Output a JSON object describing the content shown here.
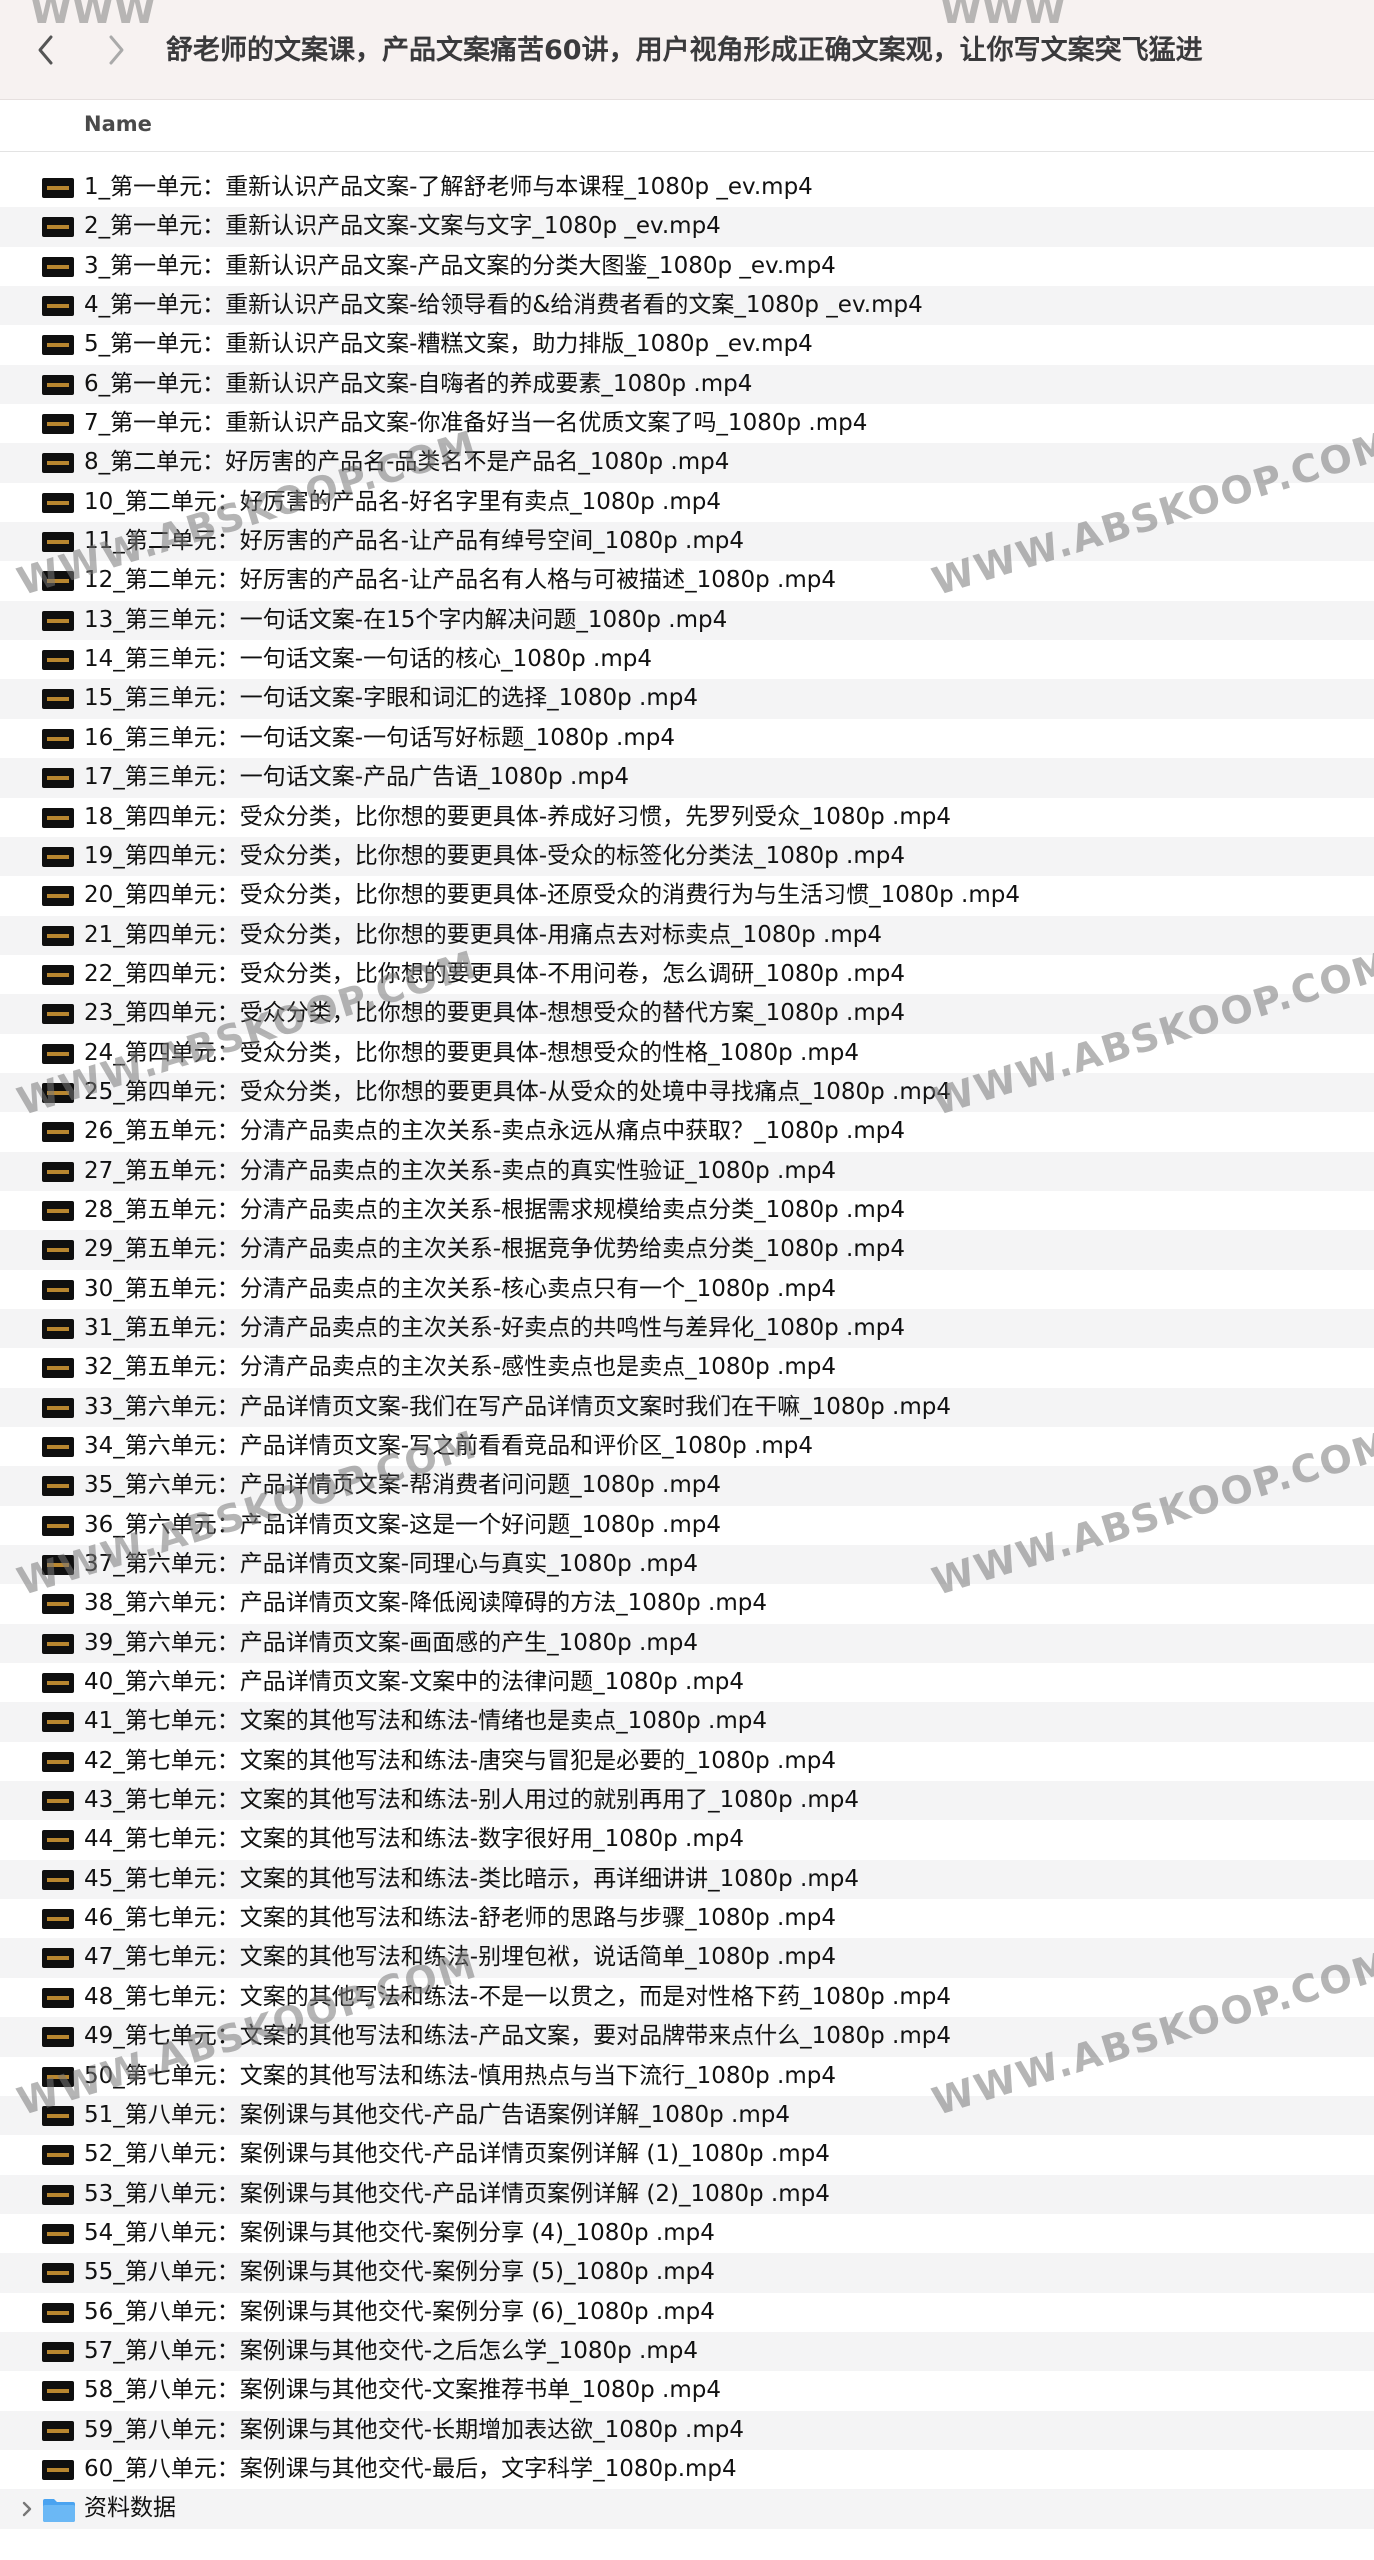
{
  "window": {
    "title": "舒老师的文案课，产品文案痛苦60讲，用户视角形成正确文案观，让你写文案突飞猛进"
  },
  "column_header": {
    "name": "Name"
  },
  "watermark": {
    "text": "WWW.ABSKOOP.COM",
    "partial_text": "WWW"
  },
  "files": [
    "1_第一单元：重新认识产品文案-了解舒老师与本课程_1080p _ev.mp4",
    "2_第一单元：重新认识产品文案-文案与文字_1080p _ev.mp4",
    "3_第一单元：重新认识产品文案-产品文案的分类大图鉴_1080p _ev.mp4",
    "4_第一单元：重新认识产品文案-给领导看的&给消费者看的文案_1080p _ev.mp4",
    "5_第一单元：重新认识产品文案-糟糕文案，助力排版_1080p _ev.mp4",
    "6_第一单元：重新认识产品文案-自嗨者的养成要素_1080p .mp4",
    "7_第一单元：重新认识产品文案-你准备好当一名优质文案了吗_1080p .mp4",
    "8_第二单元：好厉害的产品名-品类名不是产品名_1080p .mp4",
    "10_第二单元：好厉害的产品名-好名字里有卖点_1080p .mp4",
    "11_第二单元：好厉害的产品名-让产品有绰号空间_1080p .mp4",
    "12_第二单元：好厉害的产品名-让产品名有人格与可被描述_1080p .mp4",
    "13_第三单元：一句话文案-在15个字内解决问题_1080p .mp4",
    "14_第三单元：一句话文案-一句话的核心_1080p .mp4",
    "15_第三单元：一句话文案-字眼和词汇的选择_1080p .mp4",
    "16_第三单元：一句话文案-一句话写好标题_1080p .mp4",
    "17_第三单元：一句话文案-产品广告语_1080p .mp4",
    "18_第四单元：受众分类，比你想的要更具体-养成好习惯，先罗列受众_1080p .mp4",
    "19_第四单元：受众分类，比你想的要更具体-受众的标签化分类法_1080p .mp4",
    "20_第四单元：受众分类，比你想的要更具体-还原受众的消费行为与生活习惯_1080p .mp4",
    "21_第四单元：受众分类，比你想的要更具体-用痛点去对标卖点_1080p .mp4",
    "22_第四单元：受众分类，比你想的要更具体-不用问卷，怎么调研_1080p .mp4",
    "23_第四单元：受众分类，比你想的要更具体-想想受众的替代方案_1080p .mp4",
    "24_第四单元：受众分类，比你想的要更具体-想想受众的性格_1080p .mp4",
    "25_第四单元：受众分类，比你想的要更具体-从受众的处境中寻找痛点_1080p .mp4",
    "26_第五单元：分清产品卖点的主次关系-卖点永远从痛点中获取？_1080p .mp4",
    "27_第五单元：分清产品卖点的主次关系-卖点的真实性验证_1080p .mp4",
    "28_第五单元：分清产品卖点的主次关系-根据需求规模给卖点分类_1080p .mp4",
    "29_第五单元：分清产品卖点的主次关系-根据竞争优势给卖点分类_1080p .mp4",
    "30_第五单元：分清产品卖点的主次关系-核心卖点只有一个_1080p .mp4",
    "31_第五单元：分清产品卖点的主次关系-好卖点的共鸣性与差异化_1080p .mp4",
    "32_第五单元：分清产品卖点的主次关系-感性卖点也是卖点_1080p .mp4",
    "33_第六单元：产品详情页文案-我们在写产品详情页文案时我们在干嘛_1080p .mp4",
    "34_第六单元：产品详情页文案-写之前看看竞品和评价区_1080p .mp4",
    "35_第六单元：产品详情页文案-帮消费者问问题_1080p .mp4",
    "36_第六单元：产品详情页文案-这是一个好问题_1080p .mp4",
    "37_第六单元：产品详情页文案-同理心与真实_1080p .mp4",
    "38_第六单元：产品详情页文案-降低阅读障碍的方法_1080p .mp4",
    "39_第六单元：产品详情页文案-画面感的产生_1080p .mp4",
    "40_第六单元：产品详情页文案-文案中的法律问题_1080p .mp4",
    "41_第七单元：文案的其他写法和练法-情绪也是卖点_1080p .mp4",
    "42_第七单元：文案的其他写法和练法-唐突与冒犯是必要的_1080p .mp4",
    "43_第七单元：文案的其他写法和练法-别人用过的就别再用了_1080p .mp4",
    "44_第七单元：文案的其他写法和练法-数字很好用_1080p .mp4",
    "45_第七单元：文案的其他写法和练法-类比暗示，再详细讲讲_1080p .mp4",
    "46_第七单元：文案的其他写法和练法-舒老师的思路与步骤_1080p .mp4",
    "47_第七单元：文案的其他写法和练法-别埋包袱，说话简单_1080p .mp4",
    "48_第七单元：文案的其他写法和练法-不是一以贯之，而是对性格下药_1080p .mp4",
    "49_第七单元：文案的其他写法和练法-产品文案，要对品牌带来点什么_1080p .mp4",
    "50_第七单元：文案的其他写法和练法-慎用热点与当下流行_1080p .mp4",
    "51_第八单元：案例课与其他交代-产品广告语案例详解_1080p .mp4",
    "52_第八单元：案例课与其他交代-产品详情页案例详解 (1)_1080p .mp4",
    "53_第八单元：案例课与其他交代-产品详情页案例详解 (2)_1080p .mp4",
    "54_第八单元：案例课与其他交代-案例分享 (4)_1080p .mp4",
    "55_第八单元：案例课与其他交代-案例分享 (5)_1080p .mp4",
    "56_第八单元：案例课与其他交代-案例分享 (6)_1080p .mp4",
    "57_第八单元：案例课与其他交代-之后怎么学_1080p .mp4",
    "58_第八单元：案例课与其他交代-文案推荐书单_1080p .mp4",
    "59_第八单元：案例课与其他交代-长期增加表达欲_1080p .mp4",
    "60_第八单元：案例课与其他交代-最后，文字科学_1080p.mp4"
  ],
  "folder": {
    "name": "资料数据",
    "icon": "folder-icon",
    "color": "#4aa3f0"
  },
  "colors": {
    "toolbar_bg": "#f7f2f1",
    "alt_row": "#f4f4f5",
    "thumb_accent": "#b8862f"
  }
}
